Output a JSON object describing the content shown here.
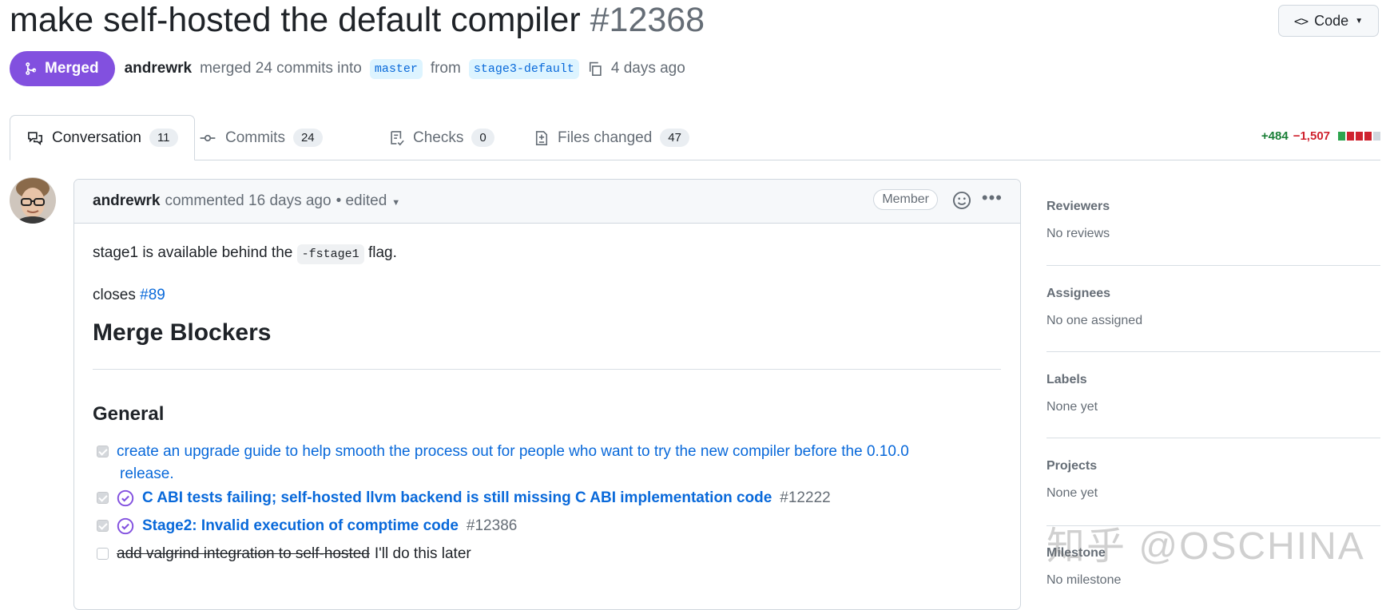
{
  "pr": {
    "title": "make self-hosted the default compiler",
    "number": "#12368",
    "state": "Merged",
    "author": "andrewrk",
    "merge_text": "merged 24 commits into",
    "base_branch": "master",
    "from_text": "from",
    "head_branch": "stage3-default",
    "time": "4 days ago"
  },
  "code_button": {
    "label": "Code"
  },
  "tabs": [
    {
      "label": "Conversation",
      "count": "11",
      "active": true
    },
    {
      "label": "Commits",
      "count": "24"
    },
    {
      "label": "Checks",
      "count": "0"
    },
    {
      "label": "Files changed",
      "count": "47"
    }
  ],
  "diffstat": {
    "additions": "+484",
    "deletions": "−1,507"
  },
  "comment": {
    "author": "andrewrk",
    "action": "commented 16 days ago",
    "edited": "• edited",
    "role": "Member",
    "body": {
      "p1_before": "stage1 is available behind the",
      "p1_code": "-fstage1",
      "p1_after": "flag.",
      "p2_before": "closes",
      "p2_link": "#89",
      "h2": "Merge Blockers",
      "h3": "General",
      "tasks": [
        {
          "line1": "create an upgrade guide to help smooth the process out for people who want to try the new compiler before the 0.10.0",
          "line2": "release."
        },
        {
          "title": "C ABI tests failing; self-hosted llvm backend is still missing C ABI implementation code",
          "number": "#12222"
        },
        {
          "title": "Stage2: Invalid execution of comptime code",
          "number": "#12386"
        },
        {
          "struck": "add valgrind integration to self-hosted",
          "note": "I'll do this later"
        }
      ]
    }
  },
  "sidebar": [
    {
      "title": "Reviewers",
      "value": "No reviews"
    },
    {
      "title": "Assignees",
      "value": "No one assigned"
    },
    {
      "title": "Labels",
      "value": "None yet"
    },
    {
      "title": "Projects",
      "value": "None yet"
    },
    {
      "title": "Milestone",
      "value": "No milestone"
    }
  ],
  "watermark": "知乎 @OSCHINA",
  "colors": {
    "merged": "#8250df",
    "link": "#0969da",
    "add": "#1a7f37",
    "del": "#cf222e"
  },
  "icons": [
    "code-icon",
    "git-merge-icon",
    "copy-icon",
    "conversation-icon",
    "commit-icon",
    "checklist-icon",
    "file-diff-icon",
    "smiley-icon",
    "kebab-icon",
    "issue-closed-icon"
  ]
}
